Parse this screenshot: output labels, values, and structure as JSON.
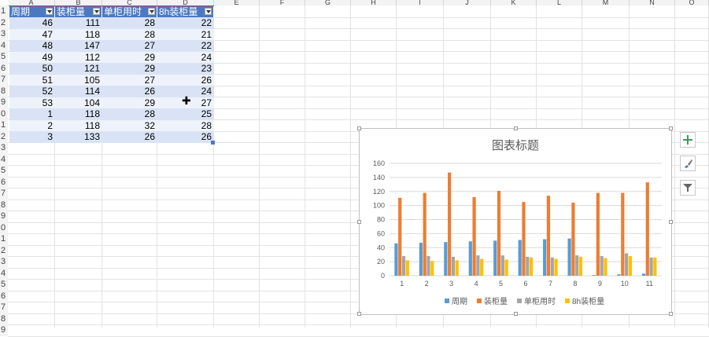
{
  "columns": [
    "A",
    "B",
    "C",
    "D",
    "E",
    "F",
    "G",
    "H",
    "I",
    "J",
    "K",
    "L",
    "M",
    "N",
    "O"
  ],
  "rows": [
    "1",
    "2",
    "3",
    "4",
    "5",
    "6",
    "7",
    "8",
    "9",
    "0",
    "1",
    "2",
    "3",
    "4",
    "5",
    "6",
    "7",
    "8",
    "9",
    "0",
    "1",
    "2",
    "3",
    "4",
    "5",
    "6",
    "7",
    "8",
    "9"
  ],
  "table": {
    "headers": [
      "周期",
      "装柜量",
      "单柜用时",
      "8h装柜量"
    ],
    "rows": [
      [
        "46",
        "111",
        "28",
        "22"
      ],
      [
        "47",
        "118",
        "28",
        "21"
      ],
      [
        "48",
        "147",
        "27",
        "22"
      ],
      [
        "49",
        "112",
        "29",
        "24"
      ],
      [
        "50",
        "121",
        "29",
        "23"
      ],
      [
        "51",
        "105",
        "27",
        "26"
      ],
      [
        "52",
        "114",
        "26",
        "24"
      ],
      [
        "53",
        "104",
        "29",
        "27"
      ],
      [
        "1",
        "118",
        "28",
        "25"
      ],
      [
        "2",
        "118",
        "32",
        "28"
      ],
      [
        "3",
        "133",
        "26",
        "26"
      ]
    ]
  },
  "chart_data": {
    "type": "bar",
    "title": "图表标题",
    "categories": [
      "1",
      "2",
      "3",
      "4",
      "5",
      "6",
      "7",
      "8",
      "9",
      "10",
      "11"
    ],
    "series": [
      {
        "name": "周期",
        "color": "#5b9bd5",
        "values": [
          46,
          47,
          48,
          49,
          50,
          51,
          52,
          53,
          1,
          2,
          3
        ]
      },
      {
        "name": "装柜量",
        "color": "#ed7d31",
        "values": [
          111,
          118,
          147,
          112,
          121,
          105,
          114,
          104,
          118,
          118,
          133
        ]
      },
      {
        "name": "单柜用时",
        "color": "#a5a5a5",
        "values": [
          28,
          28,
          27,
          29,
          29,
          27,
          26,
          29,
          28,
          32,
          26
        ]
      },
      {
        "name": "8h装柜量",
        "color": "#ffc000",
        "values": [
          22,
          21,
          22,
          24,
          23,
          26,
          24,
          27,
          25,
          28,
          26
        ]
      }
    ],
    "yticks": [
      "0",
      "20",
      "40",
      "60",
      "80",
      "100",
      "120",
      "140",
      "160"
    ],
    "ylim": [
      0,
      160
    ],
    "legend": "bottom",
    "grid": true
  },
  "chart_tools": {
    "add": "chart-elements-icon",
    "style": "brush-icon",
    "filter": "filter-icon"
  },
  "colors": {
    "header_fill": "#4a79c2",
    "band_dark": "#d9e3f5",
    "band_light": "#eef3fb"
  }
}
